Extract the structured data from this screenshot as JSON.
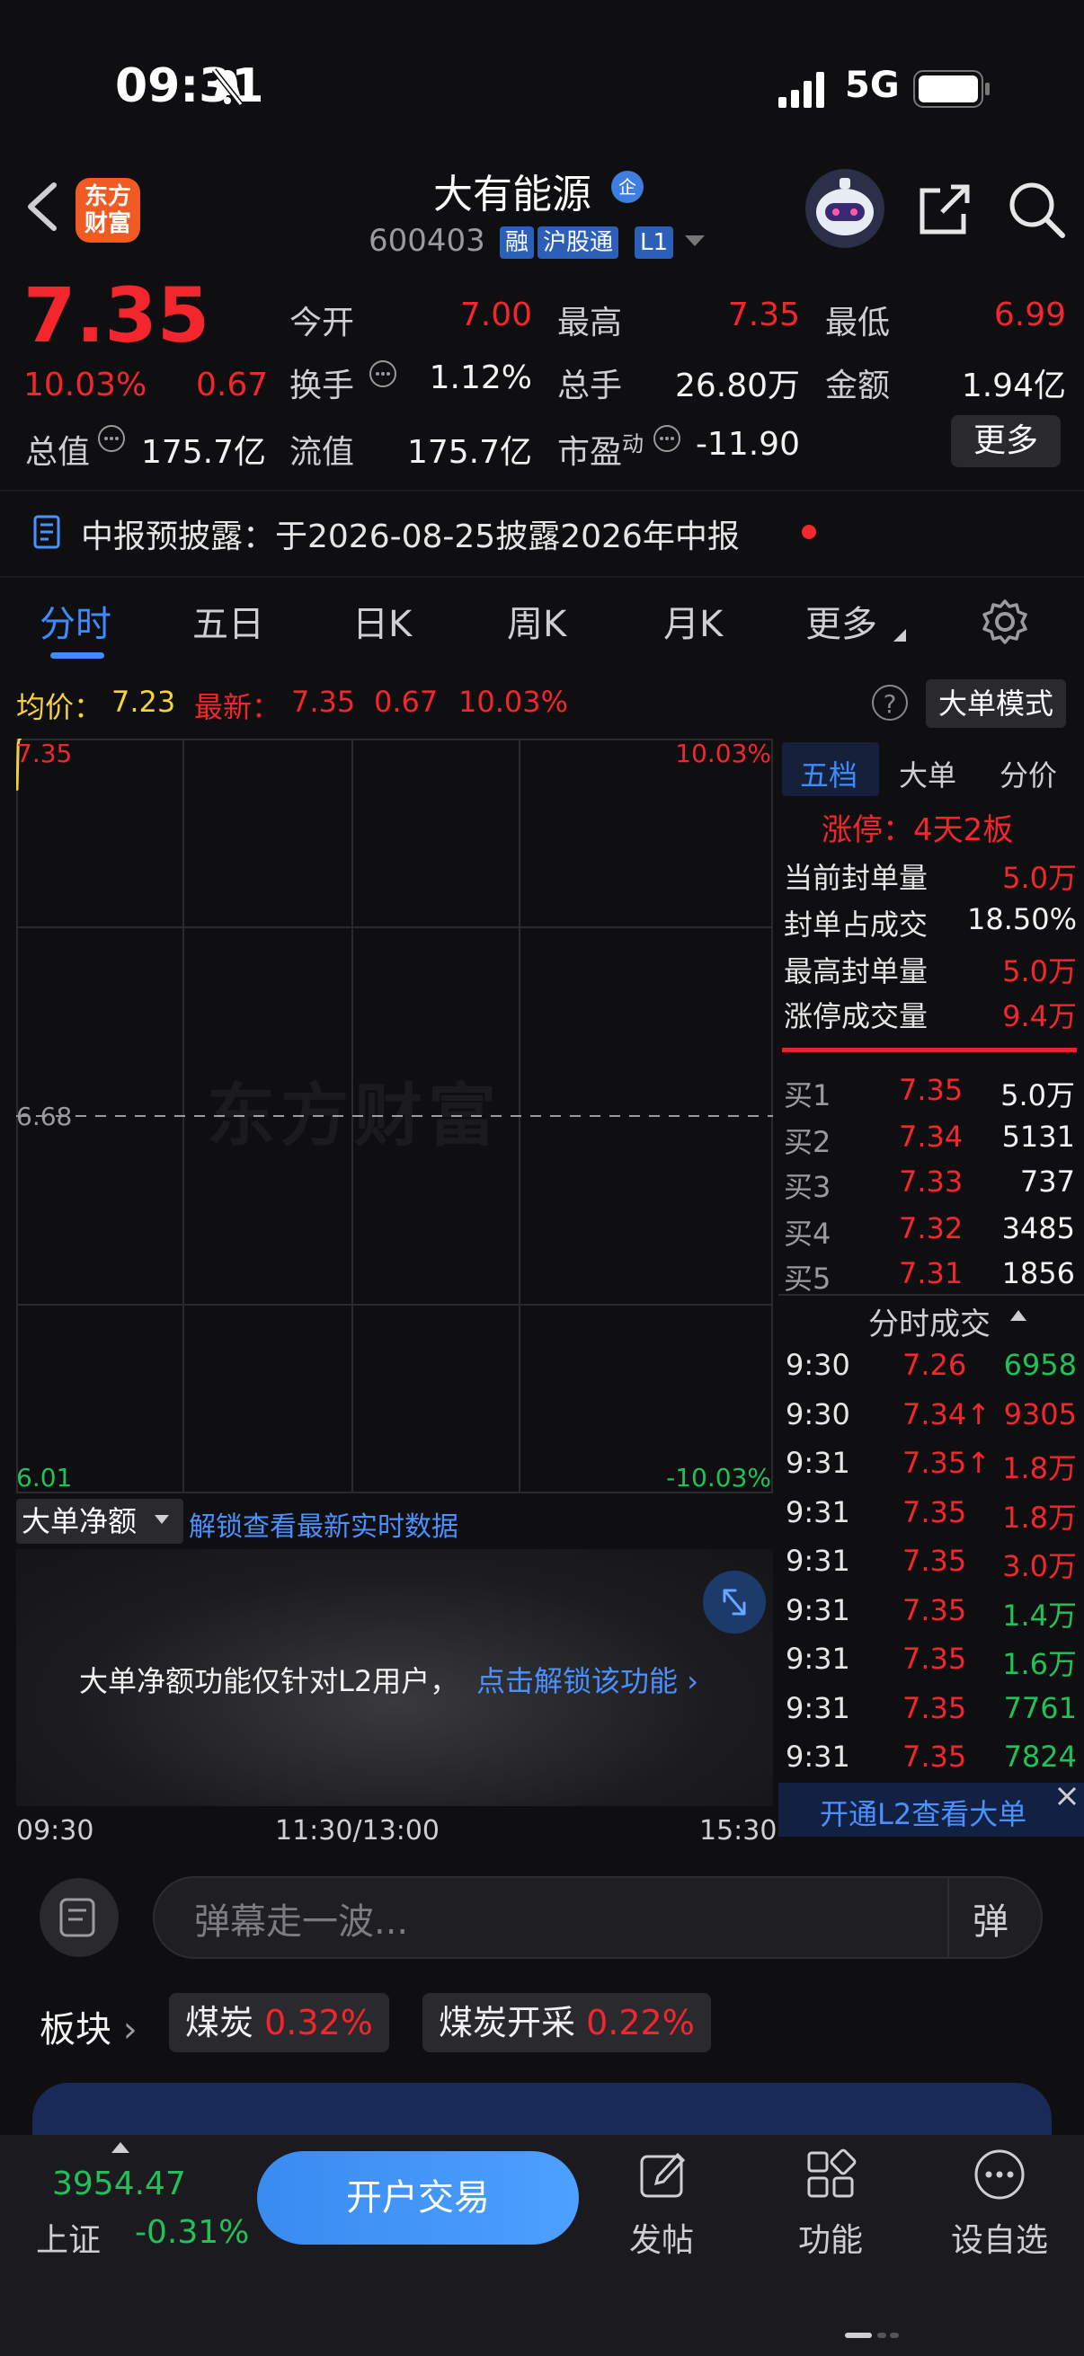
{
  "status_bar": {
    "time": "09:31",
    "network": "5G"
  },
  "header": {
    "app_logo": "东方\n财富",
    "stock_name": "大有能源",
    "badge": "企",
    "code": "600403",
    "tags": [
      "融",
      "沪股通",
      "L1"
    ]
  },
  "quote": {
    "price": "7.35",
    "pct": "10.03%",
    "change": "0.67",
    "rows": [
      [
        {
          "label": "今开",
          "value": "7.00",
          "color": "red"
        },
        {
          "label": "最高",
          "value": "7.35",
          "color": "red"
        },
        {
          "label": "最低",
          "value": "6.99",
          "color": "red"
        }
      ],
      [
        {
          "label": "换手",
          "value": "1.12%",
          "color": "white"
        },
        {
          "label": "总手",
          "value": "26.80万",
          "color": "white"
        },
        {
          "label": "金额",
          "value": "1.94亿",
          "color": "white"
        }
      ],
      [
        {
          "label": "总值",
          "value": "175.7亿",
          "color": "white"
        },
        {
          "label": "流值",
          "value": "175.7亿",
          "color": "white"
        },
        {
          "label": "市盈",
          "sup": "动",
          "value": "-11.90",
          "color": "white"
        }
      ]
    ],
    "more_label": "更多"
  },
  "notice": {
    "text": "中报预披露：于2026-08-25披露2026年中报"
  },
  "tabs": [
    "分时",
    "五日",
    "日K",
    "周K",
    "月K",
    "更多"
  ],
  "active_tab": 0,
  "avg_row": {
    "avg_label": "均价：",
    "avg_value": "7.23",
    "latest_label": "最新：",
    "latest_value": "7.35",
    "change": "0.67",
    "pct": "10.03%",
    "help_icon": "?",
    "mode_btn": "大单模式"
  },
  "chart_data": {
    "type": "line",
    "title": "",
    "y_left_ticks": [
      "7.35",
      "6.68",
      "6.01"
    ],
    "y_right_ticks": [
      "10.03%",
      "-10.03%"
    ],
    "ylim": [
      6.01,
      7.35
    ],
    "baseline": 6.68,
    "x_ticks": [
      "09:30",
      "11:30/13:00",
      "15:30"
    ],
    "series": [
      {
        "x": [
          "09:30",
          "09:30",
          "09:31",
          "09:31"
        ],
        "values": [
          7.26,
          7.34,
          7.35,
          7.35
        ]
      }
    ],
    "watermark": "东方财富"
  },
  "right_panel": {
    "tabs": [
      "五档",
      "大单",
      "分价"
    ],
    "limit_title": "涨停：4天2板",
    "stats": [
      {
        "label": "当前封单量",
        "value": "5.0万",
        "color": "red"
      },
      {
        "label": "封单占成交",
        "value": "18.50%",
        "color": "white"
      },
      {
        "label": "最高封单量",
        "value": "5.0万",
        "color": "red"
      },
      {
        "label": "涨停成交量",
        "value": "9.4万",
        "color": "red"
      }
    ],
    "bids": [
      {
        "label": "买1",
        "price": "7.35",
        "vol": "5.0万"
      },
      {
        "label": "买2",
        "price": "7.34",
        "vol": "5131"
      },
      {
        "label": "买3",
        "price": "7.33",
        "vol": "737"
      },
      {
        "label": "买4",
        "price": "7.32",
        "vol": "3485"
      },
      {
        "label": "买5",
        "price": "7.31",
        "vol": "1856"
      }
    ],
    "ticks_title": "分时成交",
    "ticks": [
      {
        "t": "9:30",
        "p": "7.26",
        "v": "6958",
        "vc": "green"
      },
      {
        "t": "9:30",
        "p": "7.34↑",
        "v": "9305",
        "vc": "red"
      },
      {
        "t": "9:31",
        "p": "7.35↑",
        "v": "1.8万",
        "vc": "red"
      },
      {
        "t": "9:31",
        "p": "7.35",
        "v": "1.8万",
        "vc": "red"
      },
      {
        "t": "9:31",
        "p": "7.35",
        "v": "3.0万",
        "vc": "red"
      },
      {
        "t": "9:31",
        "p": "7.35",
        "v": "1.4万",
        "vc": "green"
      },
      {
        "t": "9:31",
        "p": "7.35",
        "v": "1.6万",
        "vc": "green"
      },
      {
        "t": "9:31",
        "p": "7.35",
        "v": "7761",
        "vc": "green"
      },
      {
        "t": "9:31",
        "p": "7.35",
        "v": "7824",
        "vc": "green"
      }
    ],
    "l2_text": "开通L2查看大单"
  },
  "big_net": {
    "label": "大单净额",
    "link": "解锁查看最新实时数据",
    "msg": "大单净额功能仅针对L2用户，",
    "unlock": "点击解锁该功能"
  },
  "comment": {
    "placeholder": "弹幕走一波...",
    "dan_label": "弹"
  },
  "sectors": {
    "label": "板块",
    "items": [
      {
        "name": "煤炭",
        "pct": "0.32%"
      },
      {
        "name": "煤炭开采",
        "pct": "0.22%"
      }
    ]
  },
  "banner": {
    "text": ""
  },
  "bottom": {
    "index_value": "3954.47",
    "index_name": "上证",
    "index_pct": "-0.31%",
    "trade_btn": "开户交易",
    "actions": [
      "发帖",
      "功能",
      "设自选"
    ]
  },
  "colors": {
    "red": "#f2262c",
    "green": "#21c15a",
    "blue": "#3d8bff",
    "yellow": "#f4d23b"
  }
}
